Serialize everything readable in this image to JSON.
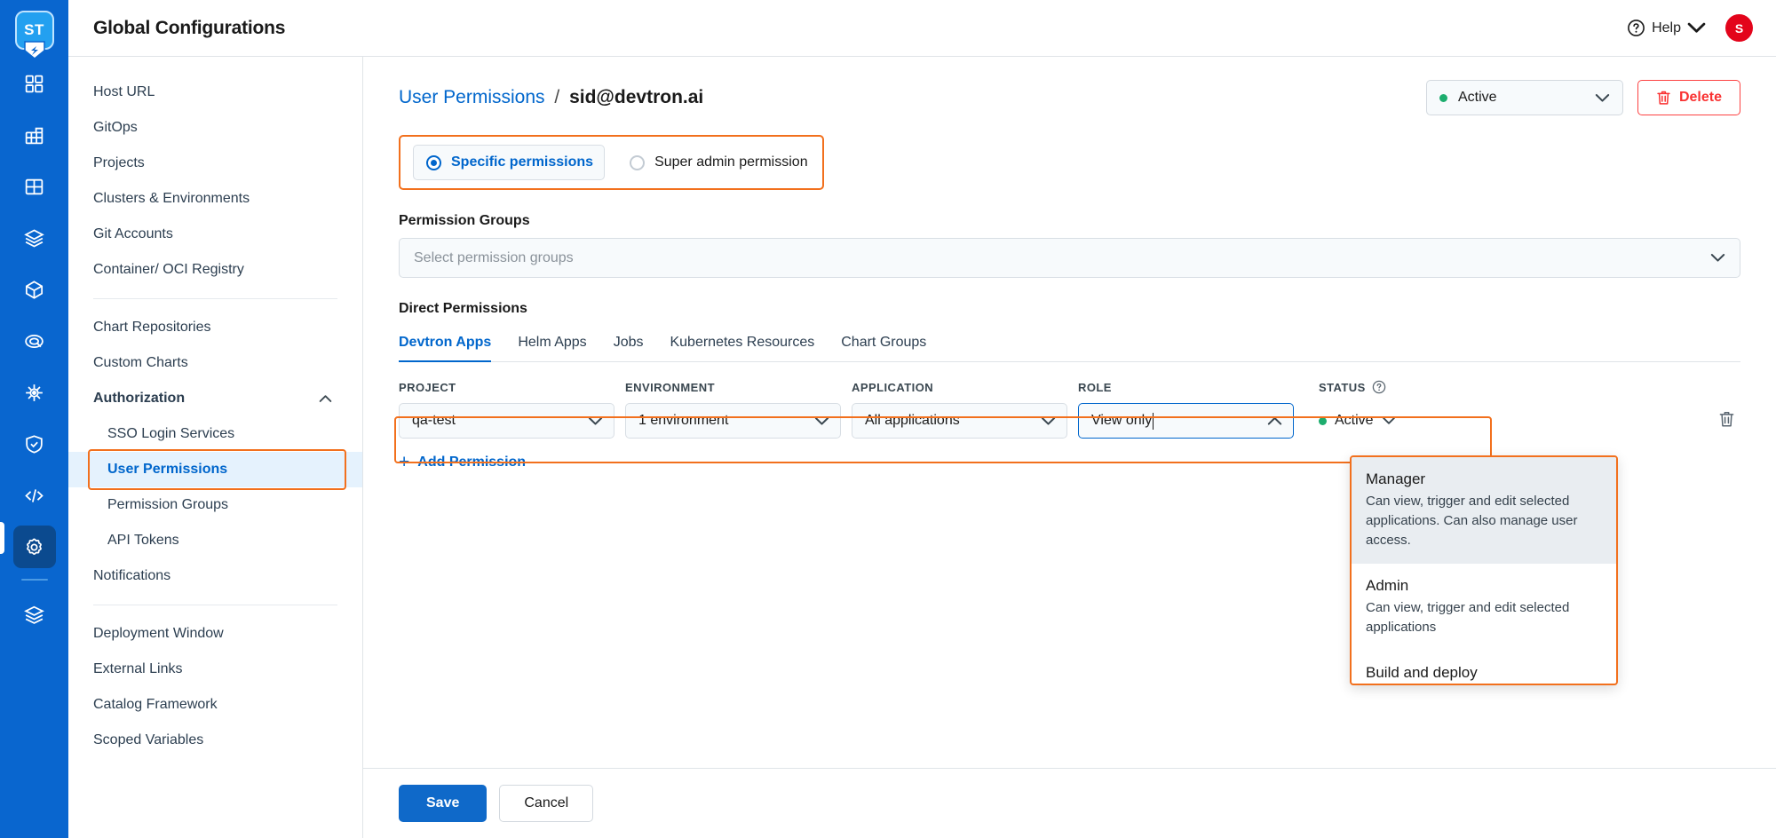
{
  "topbar": {
    "title": "Global Configurations",
    "help_label": "Help",
    "avatar_initial": "S"
  },
  "rail": {
    "logo_text": "ST",
    "items": [
      {
        "icon": "grid-apps-icon",
        "name": "rail-item-applications"
      },
      {
        "icon": "chart-grid-icon",
        "name": "rail-item-jobs"
      },
      {
        "icon": "layout-grid-icon",
        "name": "rail-item-app-groups"
      },
      {
        "icon": "stacked-box-icon",
        "name": "rail-item-chart-store"
      },
      {
        "icon": "cube-icon",
        "name": "rail-item-resource-browser"
      },
      {
        "icon": "target-icon",
        "name": "rail-item-bulk-edit"
      },
      {
        "icon": "ship-wheel-icon",
        "name": "rail-item-clusters"
      },
      {
        "icon": "shield-check-icon",
        "name": "rail-item-security"
      },
      {
        "icon": "code-brackets-icon",
        "name": "rail-item-code"
      },
      {
        "icon": "gear-icon",
        "name": "rail-item-global-configurations",
        "active": true
      },
      {
        "icon": "layers-icon",
        "name": "rail-item-stack-manager"
      }
    ]
  },
  "subnav": {
    "items": [
      {
        "label": "Host URL",
        "type": "item"
      },
      {
        "label": "GitOps",
        "type": "item"
      },
      {
        "label": "Projects",
        "type": "item"
      },
      {
        "label": "Clusters & Environments",
        "type": "item"
      },
      {
        "label": "Git Accounts",
        "type": "item"
      },
      {
        "label": "Container/ OCI Registry",
        "type": "item"
      },
      {
        "label": "divider",
        "type": "divider"
      },
      {
        "label": "Chart Repositories",
        "type": "item"
      },
      {
        "label": "Custom Charts",
        "type": "item"
      },
      {
        "label": "Authorization",
        "type": "group",
        "expanded": true
      },
      {
        "label": "SSO Login Services",
        "type": "sub"
      },
      {
        "label": "User Permissions",
        "type": "sub",
        "active": true,
        "highlighted": true
      },
      {
        "label": "Permission Groups",
        "type": "sub"
      },
      {
        "label": "API Tokens",
        "type": "sub"
      },
      {
        "label": "Notifications",
        "type": "item"
      },
      {
        "label": "divider2",
        "type": "divider"
      },
      {
        "label": "Deployment Window",
        "type": "item"
      },
      {
        "label": "External Links",
        "type": "item"
      },
      {
        "label": "Catalog Framework",
        "type": "item"
      },
      {
        "label": "Scoped Variables",
        "type": "item"
      }
    ]
  },
  "page": {
    "breadcrumb_parent": "User Permissions",
    "breadcrumb_sep": "/",
    "breadcrumb_current": "sid@devtron.ai",
    "user_status_value": "Active",
    "delete_label": "Delete"
  },
  "permission_type": {
    "specific_label": "Specific permissions",
    "specific_selected": true,
    "superadmin_label": "Super admin permission",
    "superadmin_selected": false
  },
  "permission_groups": {
    "label": "Permission Groups",
    "placeholder": "Select permission groups"
  },
  "direct_permissions": {
    "label": "Direct Permissions",
    "tabs": [
      {
        "label": "Devtron Apps",
        "active": true
      },
      {
        "label": "Helm Apps",
        "active": false
      },
      {
        "label": "Jobs",
        "active": false
      },
      {
        "label": "Kubernetes Resources",
        "active": false
      },
      {
        "label": "Chart Groups",
        "active": false
      }
    ],
    "columns": {
      "project": "PROJECT",
      "environment": "ENVIRONMENT",
      "application": "APPLICATION",
      "role": "ROLE",
      "status": "STATUS"
    },
    "row": {
      "project": "qa-test",
      "environment": "1 environment",
      "application": "All applications",
      "role": "View only",
      "role_focused": true,
      "status": "Active"
    },
    "add_permission_label": "Add Permission"
  },
  "role_dropdown": {
    "open": true,
    "options": [
      {
        "title": "Manager",
        "description": "Can view, trigger and edit selected applications. Can also manage user access.",
        "highlighted": true
      },
      {
        "title": "Admin",
        "description": "Can view, trigger and edit selected applications",
        "highlighted": false
      },
      {
        "title": "Build and deploy",
        "description": "",
        "highlighted": false
      }
    ]
  },
  "footer": {
    "save_label": "Save",
    "cancel_label": "Cancel"
  },
  "colors": {
    "brand_blue": "#0966cf",
    "link_blue": "#0066cc",
    "highlight_orange": "#f2701d",
    "danger_red": "#f93232",
    "status_green": "#1dad6e",
    "avatar_red": "#e3041b"
  }
}
